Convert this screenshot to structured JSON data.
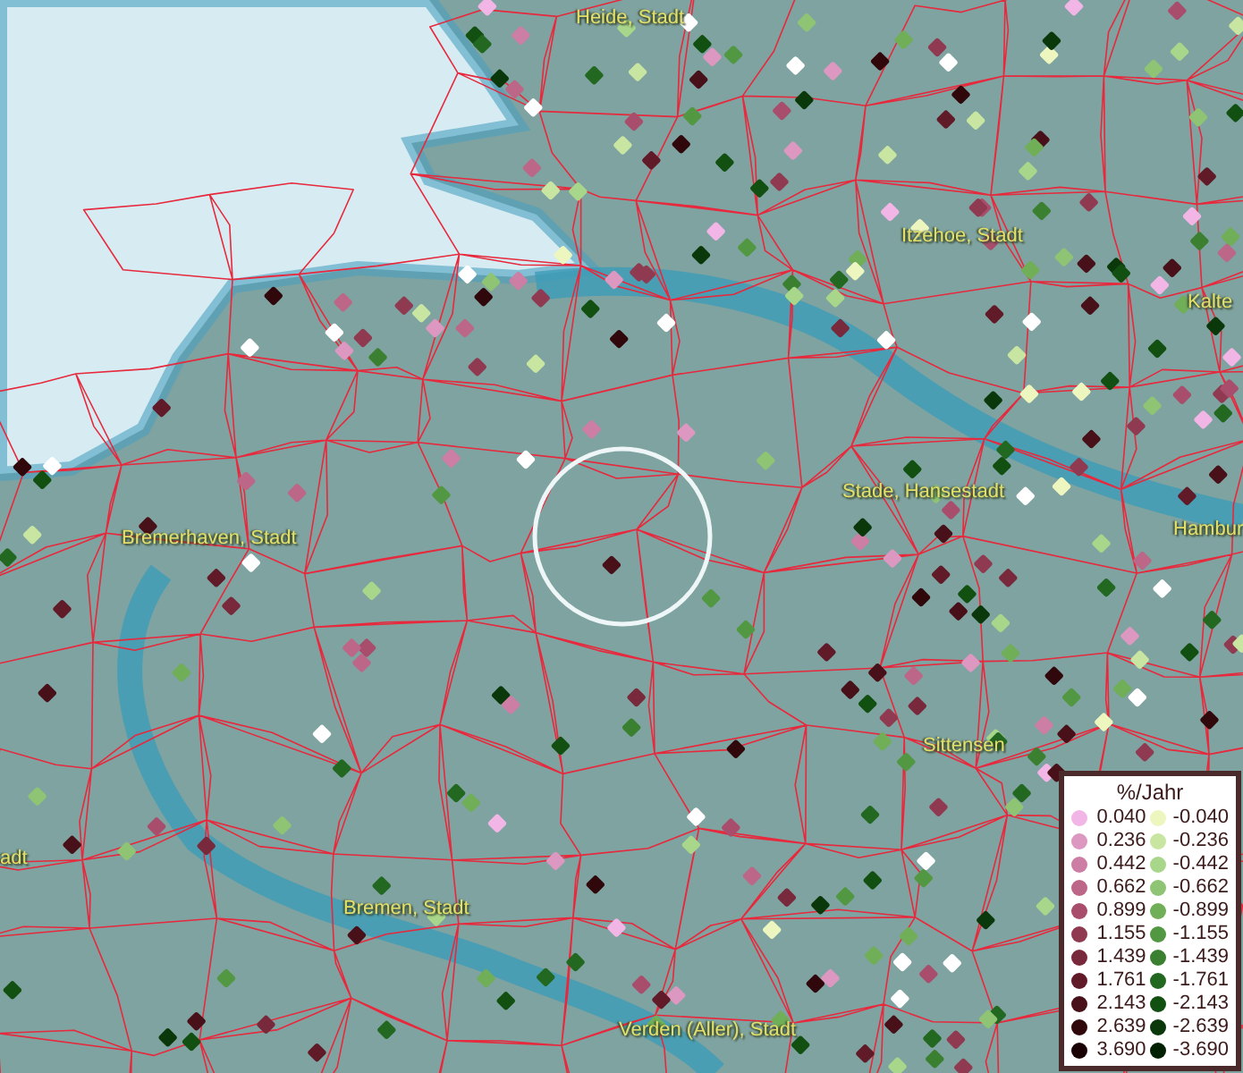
{
  "map": {
    "place_labels": [
      {
        "text": "Heide, Stadt"
      },
      {
        "text": "Itzehoe, Stadt"
      },
      {
        "text": "Kalte"
      },
      {
        "text": "Stade, Hansestadt"
      },
      {
        "text": "Hambur"
      },
      {
        "text": "Bremerhaven, Stadt"
      },
      {
        "text": "Sittensen"
      },
      {
        "text": "adt"
      },
      {
        "text": "Bremen, Stadt"
      },
      {
        "text": "Verden (Aller), Stadt"
      }
    ]
  },
  "legend": {
    "title": "%/Jahr",
    "rows": [
      {
        "positive": {
          "value": "0.040",
          "color": "#f2b6e6"
        },
        "negative": {
          "value": "-0.040",
          "color": "#eef6c0"
        }
      },
      {
        "positive": {
          "value": "0.236",
          "color": "#dc98c0"
        },
        "negative": {
          "value": "-0.236",
          "color": "#c8e6a2"
        }
      },
      {
        "positive": {
          "value": "0.442",
          "color": "#cc7ea4"
        },
        "negative": {
          "value": "-0.442",
          "color": "#a8d68a"
        }
      },
      {
        "positive": {
          "value": "0.662",
          "color": "#bc6688"
        },
        "negative": {
          "value": "-0.662",
          "color": "#8ec474"
        }
      },
      {
        "positive": {
          "value": "0.899",
          "color": "#a84e6c"
        },
        "negative": {
          "value": "-0.899",
          "color": "#70ae58"
        }
      },
      {
        "positive": {
          "value": "1.155",
          "color": "#903a52"
        },
        "negative": {
          "value": "-1.155",
          "color": "#529842"
        }
      },
      {
        "positive": {
          "value": "1.439",
          "color": "#782a3c"
        },
        "negative": {
          "value": "-1.439",
          "color": "#3a8030"
        }
      },
      {
        "positive": {
          "value": "1.761",
          "color": "#601a28"
        },
        "negative": {
          "value": "-1.761",
          "color": "#226820"
        }
      },
      {
        "positive": {
          "value": "2.143",
          "color": "#481018"
        },
        "negative": {
          "value": "-2.143",
          "color": "#125012"
        }
      },
      {
        "positive": {
          "value": "2.639",
          "color": "#30080c"
        },
        "negative": {
          "value": "-2.639",
          "color": "#0a380a"
        }
      },
      {
        "positive": {
          "value": "3.690",
          "color": "#1a0204"
        },
        "negative": {
          "value": "-3.690",
          "color": "#022002"
        }
      }
    ]
  }
}
